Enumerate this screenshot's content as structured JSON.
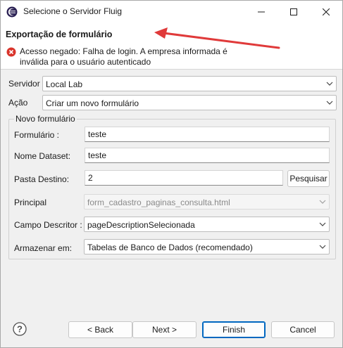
{
  "window": {
    "title": "Selecione o Servidor Fluig"
  },
  "header": {
    "title": "Exportação de formulário",
    "error_line1": "Acesso negado: Falha de login. A empresa informada é",
    "error_line2": "inválida para o usuário autenticado"
  },
  "form": {
    "servidor": {
      "label": "Servidor",
      "value": "Local Lab"
    },
    "acao": {
      "label": "Ação",
      "value": "Criar um novo formulário"
    },
    "group_title": "Novo formulário",
    "formulario": {
      "label": "Formulário :",
      "value": "teste"
    },
    "nome_dataset": {
      "label": "Nome Dataset:",
      "value": "teste"
    },
    "pasta_destino": {
      "label": "Pasta Destino:",
      "value": "2",
      "button": "Pesquisar"
    },
    "principal": {
      "label": "Principal",
      "value": "form_cadastro_paginas_consulta.html"
    },
    "campo_descritor": {
      "label": "Campo Descritor :",
      "value": "pageDescriptionSelecionada"
    },
    "armazenar_em": {
      "label": "Armazenar em:",
      "value": "Tabelas de Banco de Dados (recomendado)"
    }
  },
  "footer": {
    "back": "< Back",
    "next": "Next >",
    "finish": "Finish",
    "cancel": "Cancel"
  },
  "colors": {
    "error_red": "#d9342b",
    "arrow_red": "#e03a3a",
    "accent_blue": "#0067c0"
  },
  "icons": {
    "app": "eclipse-icon",
    "error": "error-icon",
    "help": "help-icon"
  }
}
